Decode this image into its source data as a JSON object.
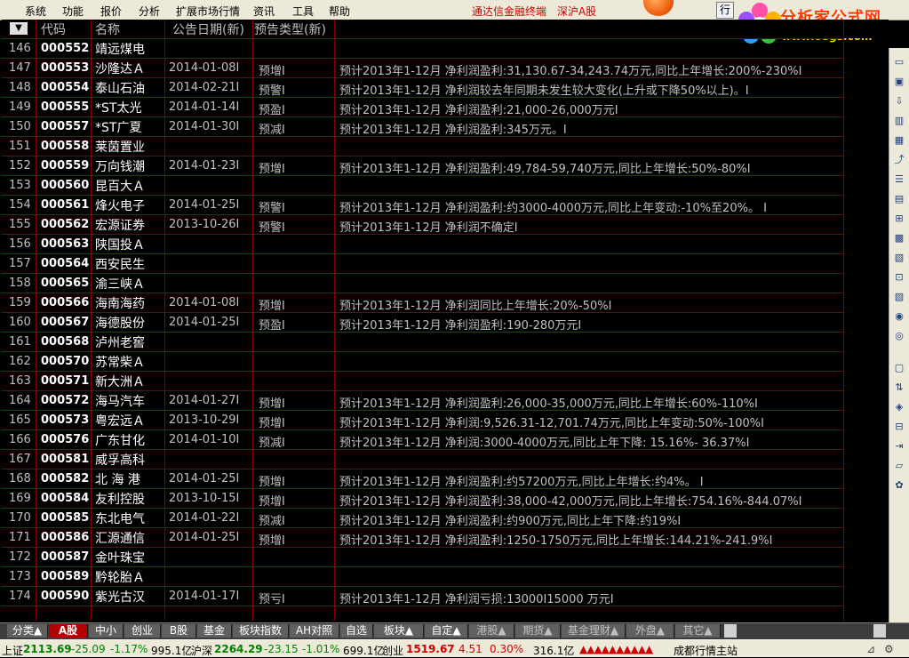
{
  "menu": {
    "items": [
      "系统",
      "功能",
      "报价",
      "分析",
      "扩展市场行情",
      "资讯",
      "工具",
      "帮助"
    ],
    "app_title": "通达信金融终端",
    "market": "深沪A股",
    "right_btn": "行"
  },
  "logo": {
    "title": "分析家公式网",
    "url": "www.88gs.com"
  },
  "table": {
    "headers": {
      "sort": "▼",
      "code": "代码",
      "name": "名称",
      "date": "公告日期(新)",
      "type": "预告类型(新)"
    },
    "rows": [
      {
        "idx": "146",
        "code": "000552",
        "name": "靖远煤电",
        "date": "",
        "type": "",
        "detail": ""
      },
      {
        "idx": "147",
        "code": "000553",
        "name": "沙隆达Ａ",
        "date": "2014-01-08I",
        "type": "预增I",
        "detail": "预计2013年1-12月 净利润盈利:31,130.67-34,243.74万元,同比上年增长:200%-230%I"
      },
      {
        "idx": "148",
        "code": "000554",
        "name": "泰山石油",
        "date": "2014-02-21I",
        "type": "预警I",
        "detail": "预计2013年1-12月  净利润较去年同期未发生较大变化(上升或下降50%以上)。I"
      },
      {
        "idx": "149",
        "code": "000555",
        "name": "*ST太光",
        "date": "2014-01-14I",
        "type": "预盈I",
        "detail": "预计2013年1-12月 净利润盈利:21,000-26,000万元I"
      },
      {
        "idx": "150",
        "code": "000557",
        "name": "*ST广夏",
        "date": "2014-01-30I",
        "type": "预减I",
        "detail": "预计2013年1-12月 净利润盈利:345万元。I"
      },
      {
        "idx": "151",
        "code": "000558",
        "name": "莱茵置业",
        "date": "",
        "type": "",
        "detail": ""
      },
      {
        "idx": "152",
        "code": "000559",
        "name": "万向钱潮",
        "date": "2014-01-23I",
        "type": "预增I",
        "detail": "预计2013年1-12月 净利润盈利:49,784-59,740万元,同比上年增长:50%-80%I"
      },
      {
        "idx": "153",
        "code": "000560",
        "name": "昆百大Ａ",
        "date": "",
        "type": "",
        "detail": ""
      },
      {
        "idx": "154",
        "code": "000561",
        "name": "烽火电子",
        "date": "2014-01-25I",
        "type": "预警I",
        "detail": "预计2013年1-12月 净利润盈利:约3000-4000万元,同比上年变动:-10%至20%。 I"
      },
      {
        "idx": "155",
        "code": "000562",
        "name": "宏源证券",
        "date": "2013-10-26I",
        "type": "预警I",
        "detail": "预计2013年1-12月 净利润不确定I"
      },
      {
        "idx": "156",
        "code": "000563",
        "name": "陕国投Ａ",
        "date": "",
        "type": "",
        "detail": ""
      },
      {
        "idx": "157",
        "code": "000564",
        "name": "西安民生",
        "date": "",
        "type": "",
        "detail": ""
      },
      {
        "idx": "158",
        "code": "000565",
        "name": "渝三峡Ａ",
        "date": "",
        "type": "",
        "detail": ""
      },
      {
        "idx": "159",
        "code": "000566",
        "name": "海南海药",
        "date": "2014-01-08I",
        "type": "预增I",
        "detail": "预计2013年1-12月 净利润同比上年增长:20%-50%I"
      },
      {
        "idx": "160",
        "code": "000567",
        "name": "海德股份",
        "date": "2014-01-25I",
        "type": "预盈I",
        "detail": "预计2013年1-12月 净利润盈利:190-280万元I"
      },
      {
        "idx": "161",
        "code": "000568",
        "name": "泸州老窖",
        "date": "",
        "type": "",
        "detail": ""
      },
      {
        "idx": "162",
        "code": "000570",
        "name": "苏常柴Ａ",
        "date": "",
        "type": "",
        "detail": ""
      },
      {
        "idx": "163",
        "code": "000571",
        "name": "新大洲Ａ",
        "date": "",
        "type": "",
        "detail": ""
      },
      {
        "idx": "164",
        "code": "000572",
        "name": "海马汽车",
        "date": "2014-01-27I",
        "type": "预增I",
        "detail": "预计2013年1-12月 净利润盈利:26,000-35,000万元,同比上年增长:60%-110%I"
      },
      {
        "idx": "165",
        "code": "000573",
        "name": "粤宏远Ａ",
        "date": "2013-10-29I",
        "type": "预增I",
        "detail": "预计2013年1-12月 净利润:9,526.31-12,701.74万元,同比上年变动:50%-100%I"
      },
      {
        "idx": "166",
        "code": "000576",
        "name": "广东甘化",
        "date": "2014-01-10I",
        "type": "预减I",
        "detail": "预计2013年1-12月 净利润:3000-4000万元,同比上年下降: 15.16%- 36.37%I"
      },
      {
        "idx": "167",
        "code": "000581",
        "name": "威孚高科",
        "date": "",
        "type": "",
        "detail": ""
      },
      {
        "idx": "168",
        "code": "000582",
        "name": "北 海 港",
        "date": "2014-01-25I",
        "type": "预增I",
        "detail": "预计2013年1-12月 净利润盈利:约57200万元,同比上年增长:约4%。 I"
      },
      {
        "idx": "169",
        "code": "000584",
        "name": "友利控股",
        "date": "2013-10-15I",
        "type": "预增I",
        "detail": "预计2013年1-12月 净利润盈利:38,000-42,000万元,同比上年增长:754.16%-844.07%I"
      },
      {
        "idx": "170",
        "code": "000585",
        "name": "东北电气",
        "date": "2014-01-22I",
        "type": "预减I",
        "detail": "预计2013年1-12月 净利润盈利:约900万元,同比上年下降:约19%I"
      },
      {
        "idx": "171",
        "code": "000586",
        "name": "汇源通信",
        "date": "2014-01-25I",
        "type": "预增I",
        "detail": "预计2013年1-12月 净利润盈利:1250-1750万元,同比上年增长:144.21%-241.9%I"
      },
      {
        "idx": "172",
        "code": "000587",
        "name": "金叶珠宝",
        "date": "",
        "type": "",
        "detail": ""
      },
      {
        "idx": "173",
        "code": "000589",
        "name": "黔轮胎Ａ",
        "date": "",
        "type": "",
        "detail": ""
      },
      {
        "idx": "174",
        "code": "000590",
        "name": "紫光古汉",
        "date": "2014-01-17I",
        "type": "预亏I",
        "detail": "预计2013年1-12月 净利润亏损:13000I15000 万元I"
      }
    ]
  },
  "tabs": [
    "分类▲",
    "A股",
    "中小",
    "创业",
    "B股",
    "基金",
    "板块指数",
    "AH对照",
    "自选",
    "板块▲",
    "自定▲",
    "港股▲",
    "期货▲",
    "基金理财▲",
    "外盘▲",
    "其它▲"
  ],
  "status": {
    "sh_label": "上证",
    "sh_val": "2113.69",
    "sh_chg": "-25.09",
    "sh_pct": "-1.17%",
    "sh_amt": "995.1亿",
    "sz_label": "沪深",
    "sz_val": "2264.29",
    "sz_chg": "-23.15",
    "sz_pct": "-1.01%",
    "sz_amt": "699.1亿",
    "cy_label": "创业",
    "cy_val": "1519.67",
    "cy_chg": "4.51",
    "cy_pct": "0.30%",
    "cy_amt": "316.1亿",
    "station": "成都行情主站"
  },
  "colors": {
    "grid": "#800000",
    "active_tab": "#b00000",
    "logo": "#ff3a00"
  }
}
